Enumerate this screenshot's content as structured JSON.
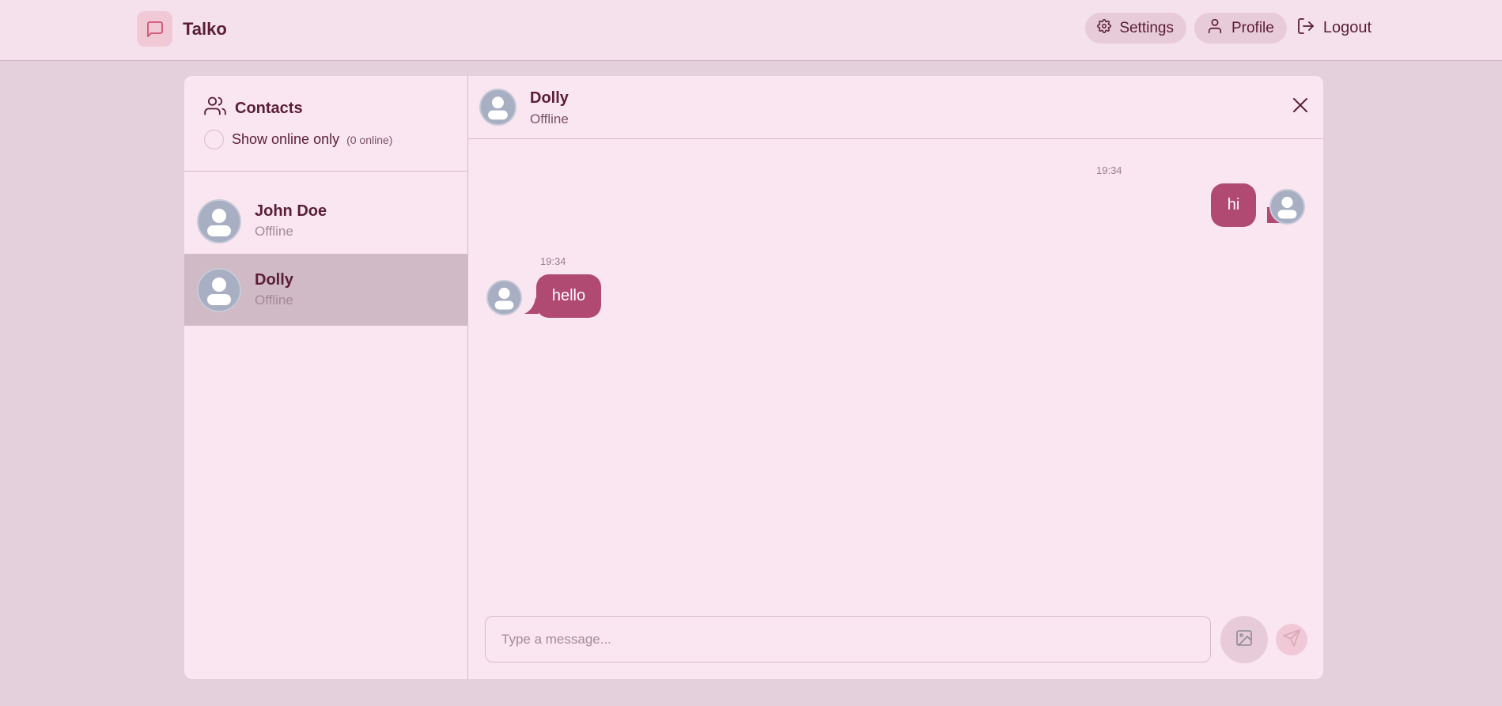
{
  "app": {
    "brand_name": "Talko",
    "brand_icon": "message-square-icon"
  },
  "nav": {
    "settings_label": "Settings",
    "profile_label": "Profile",
    "logout_label": "Logout"
  },
  "sidebar": {
    "title": "Contacts",
    "show_online_label": "Show online only",
    "online_count": "(0 online)",
    "contacts": [
      {
        "name": "John Doe",
        "status": "Offline",
        "active": false
      },
      {
        "name": "Dolly",
        "status": "Offline",
        "active": true
      }
    ]
  },
  "chat": {
    "name": "Dolly",
    "status": "Offline",
    "messages": [
      {
        "time": "19:34",
        "text": "hi",
        "from_me": true
      },
      {
        "time": "19:34",
        "text": "hello",
        "from_me": false
      }
    ],
    "input_placeholder": "Type a message..."
  },
  "colors": {
    "page_bg": "#e3d0dc",
    "panel_bg": "#f9e6f1",
    "accent": "#b04a73",
    "text": "#5a1e34"
  }
}
